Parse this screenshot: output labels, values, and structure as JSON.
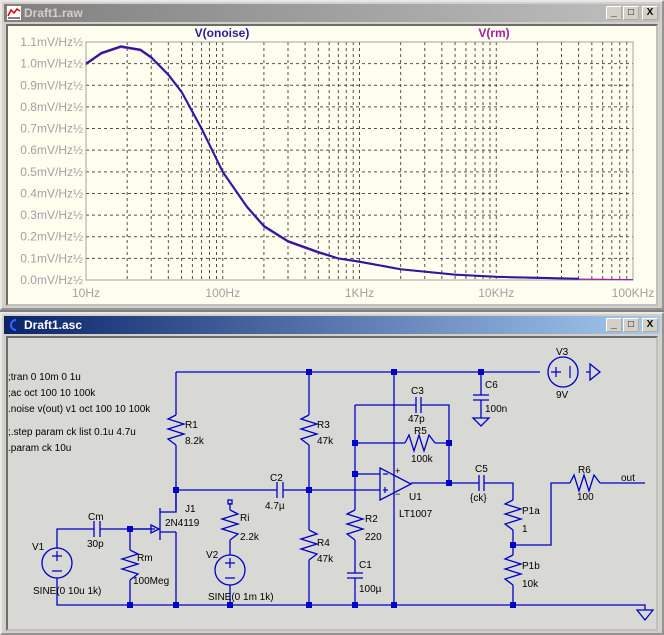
{
  "plot_window": {
    "title": "Draft1.raw",
    "buttons": {
      "minimize": "_",
      "maximize": "□",
      "close": "X"
    }
  },
  "schematic_window": {
    "title": "Draft1.asc",
    "buttons": {
      "minimize": "_",
      "maximize": "□",
      "close": "X"
    }
  },
  "colors": {
    "trace1": "#2a1aa0",
    "trace2": "#a020a0",
    "wire": "#0000c8",
    "plot_bg": "#fffff0",
    "grid": "#505050"
  },
  "chart_data": {
    "type": "line",
    "xscale": "log",
    "xlim": [
      10,
      100000
    ],
    "ylim": [
      0,
      1.1
    ],
    "x_ticks": [
      "10Hz",
      "100Hz",
      "1KHz",
      "10KHz",
      "100KHz"
    ],
    "y_ticks": [
      "0.0mV/Hz½",
      "0.1mV/Hz½",
      "0.2mV/Hz½",
      "0.3mV/Hz½",
      "0.4mV/Hz½",
      "0.5mV/Hz½",
      "0.6mV/Hz½",
      "0.7mV/Hz½",
      "0.8mV/Hz½",
      "0.9mV/Hz½",
      "1.0mV/Hz½",
      "1.1mV/Hz½"
    ],
    "grid": true,
    "series": [
      {
        "name": "V(onoise)",
        "x": [
          10,
          13,
          18,
          25,
          30,
          40,
          50,
          70,
          100,
          150,
          200,
          300,
          500,
          700,
          1000,
          2000,
          5000,
          10000,
          20000,
          40000
        ],
        "y": [
          1.0,
          1.05,
          1.08,
          1.065,
          1.03,
          0.95,
          0.87,
          0.7,
          0.5,
          0.34,
          0.25,
          0.18,
          0.13,
          0.1,
          0.085,
          0.05,
          0.025,
          0.015,
          0.01,
          0.006
        ]
      },
      {
        "name": "V(rm)",
        "x": [
          10,
          13,
          18,
          25,
          30,
          40,
          50,
          70,
          100,
          150,
          200,
          300,
          500,
          700,
          1000,
          2000,
          5000,
          10000,
          20000,
          40000,
          100000
        ],
        "y": [
          0.995,
          1.045,
          1.075,
          1.06,
          1.025,
          0.945,
          0.865,
          0.695,
          0.495,
          0.335,
          0.245,
          0.175,
          0.125,
          0.098,
          0.082,
          0.048,
          0.023,
          0.013,
          0.008,
          0.004,
          0.002
        ]
      }
    ]
  },
  "directives": [
    ";tran 0 10m 0 1u",
    ";ac oct 100 10 100k",
    ".noise v(out) v1 oct 100 10 100k",
    ";.step param ck list 0.1u 4.7u",
    ".param ck 10u"
  ],
  "components": {
    "R1": {
      "name": "R1",
      "value": "8.2k"
    },
    "R3": {
      "name": "R3",
      "value": "47k"
    },
    "R4": {
      "name": "R4",
      "value": "47k"
    },
    "C2": {
      "name": "C2",
      "value": "4.7µ"
    },
    "J1": {
      "name": "J1",
      "value": "2N4119"
    },
    "Cm": {
      "name": "Cm",
      "value": "30p"
    },
    "Rm": {
      "name": "Rm",
      "value": "100Meg"
    },
    "V1": {
      "name": "V1",
      "value": "SINE(0 10u 1k)"
    },
    "Ri": {
      "name": "Ri",
      "value": "2.2k"
    },
    "V2": {
      "name": "V2",
      "value": "SINE(0 1m 1k)"
    },
    "C3": {
      "name": "C3",
      "value": "47p"
    },
    "R5": {
      "name": "R5",
      "value": "100k"
    },
    "R2": {
      "name": "R2",
      "value": "220"
    },
    "C1": {
      "name": "C1",
      "value": "100µ"
    },
    "U1": {
      "name": "U1",
      "value": "LT1007"
    },
    "C6": {
      "name": "C6",
      "value": "100n"
    },
    "V3": {
      "name": "V3",
      "value": "9V"
    },
    "C5": {
      "name": "C5",
      "value": "{ck}"
    },
    "P1a": {
      "name": "P1a",
      "value": "1"
    },
    "P1b": {
      "name": "P1b",
      "value": "10k"
    },
    "R6": {
      "name": "R6",
      "value": "100"
    }
  },
  "net_labels": {
    "out": "out"
  }
}
